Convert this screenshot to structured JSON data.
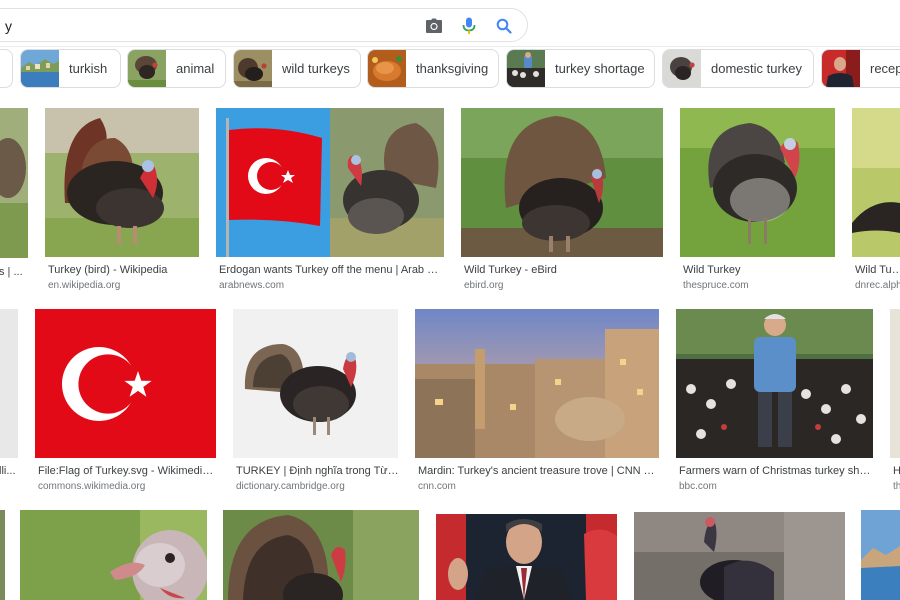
{
  "search": {
    "query": "y"
  },
  "chips": [
    {
      "label": ""
    },
    {
      "label": "turkish",
      "icon": "coastal-town-thumbnail"
    },
    {
      "label": "animal",
      "icon": "turkey-thumbnail"
    },
    {
      "label": "wild turkeys",
      "icon": "wild-turkey-thumbnail"
    },
    {
      "label": "thanksgiving",
      "icon": "roast-turkey-thumbnail"
    },
    {
      "label": "turkey shortage",
      "icon": "farmer-turkeys-thumbnail"
    },
    {
      "label": "domestic turkey",
      "icon": "domestic-turkey-thumbnail"
    },
    {
      "label": "recep",
      "icon": "politician-thumbnail"
    }
  ],
  "results": [
    {
      "title": "s | ...",
      "source": ""
    },
    {
      "title": "Turkey (bird) - Wikipedia",
      "source": "en.wikipedia.org"
    },
    {
      "title": "Erdogan wants Turkey off the menu | Arab News",
      "source": "arabnews.com"
    },
    {
      "title": "Wild Turkey - eBird",
      "source": "ebird.org"
    },
    {
      "title": "Wild Turkey",
      "source": "thespruce.com"
    },
    {
      "title": "Wild Turke",
      "source": "dnrec.alpha"
    },
    {
      "title": "lli...",
      "source": ""
    },
    {
      "title": "File:Flag of Turkey.svg - Wikimedia C...",
      "source": "commons.wikimedia.org"
    },
    {
      "title": "TURKEY | Định nghĩa trong Từ đi...",
      "source": "dictionary.cambridge.org"
    },
    {
      "title": "Mardin: Turkey's ancient treasure trove | CNN Travel",
      "source": "cnn.com"
    },
    {
      "title": "Farmers warn of Christmas turkey short...",
      "source": "bbc.com"
    },
    {
      "title": "H",
      "source": "th"
    }
  ],
  "colors": {
    "flag_red": "#e30a17",
    "link_blue": "#4285f4",
    "mic_red": "#ea4335",
    "icon_grey": "#5f6368"
  }
}
